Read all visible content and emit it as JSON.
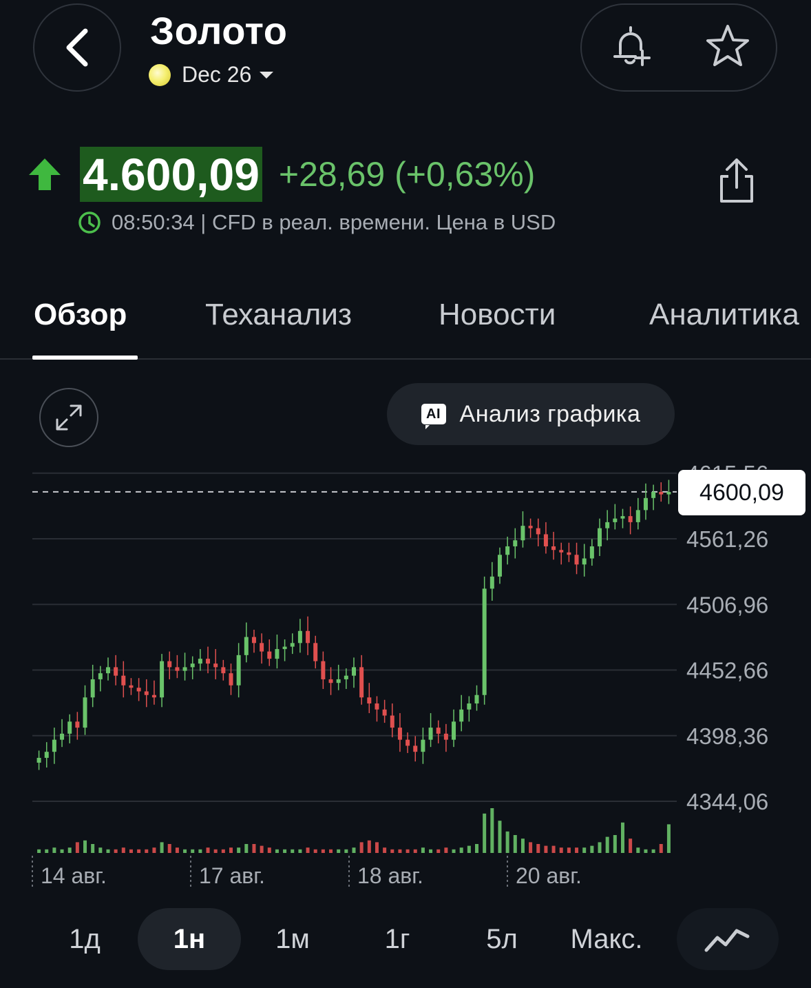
{
  "header": {
    "back_icon": "chevron-left-icon",
    "title": "Золото",
    "contract": "Dec 26",
    "alert_icon": "bell-plus-icon",
    "watchlist_icon": "star-icon"
  },
  "quote": {
    "direction_icon": "arrow-up-icon",
    "price": "4.600,09",
    "change": "+28,69 (+0,63%)",
    "time_info": "08:50:34 | CFD в реал. времени. Цена в USD",
    "share_icon": "share-icon",
    "up_color": "#6ac36a"
  },
  "tabs": [
    {
      "label": "Обзор",
      "active": true
    },
    {
      "label": "Теханализ",
      "active": false
    },
    {
      "label": "Новости",
      "active": false
    },
    {
      "label": "Аналитика",
      "active": false
    }
  ],
  "chart_controls": {
    "expand_icon": "expand-icon",
    "ai_badge": "AI",
    "ai_button": "Анализ графика"
  },
  "chart_data": {
    "type": "candlestick",
    "current_price_label": "4600,09",
    "current_price": 4600.09,
    "y_ticks": [
      "4561,26",
      "4506,96",
      "4452,66",
      "4398,36",
      "4344,06"
    ],
    "y_tick_values": [
      4561.26,
      4506.96,
      4452.66,
      4398.36,
      4344.06
    ],
    "top_tick_partial": "4615,56",
    "x_labels": [
      "14 авг.",
      "17 авг.",
      "18 авг.",
      "20 авг."
    ],
    "up_color": "#6ac36a",
    "down_color": "#e0504f",
    "candle_closes": [
      4380,
      4385,
      4395,
      4400,
      4410,
      4405,
      4430,
      4445,
      4450,
      4455,
      4448,
      4440,
      4438,
      4435,
      4432,
      4430,
      4460,
      4455,
      4452,
      4455,
      4458,
      4462,
      4458,
      4455,
      4450,
      4440,
      4465,
      4480,
      4475,
      4468,
      4462,
      4470,
      4472,
      4475,
      4485,
      4475,
      4460,
      4445,
      4442,
      4445,
      4448,
      4455,
      4430,
      4425,
      4420,
      4415,
      4405,
      4395,
      4390,
      4385,
      4395,
      4405,
      4400,
      4395,
      4410,
      4420,
      4425,
      4432,
      4520,
      4530,
      4548,
      4555,
      4560,
      4572,
      4570,
      4565,
      4555,
      4552,
      4550,
      4548,
      4540,
      4545,
      4555,
      4570,
      4575,
      4578,
      4580,
      4575,
      4585,
      4595,
      4600,
      4598,
      4600
    ],
    "volumes": [
      2,
      2,
      3,
      2,
      3,
      6,
      7,
      5,
      3,
      2,
      2,
      3,
      2,
      2,
      2,
      3,
      6,
      5,
      3,
      2,
      2,
      2,
      3,
      2,
      2,
      3,
      3,
      5,
      5,
      4,
      3,
      2,
      2,
      2,
      2,
      3,
      2,
      2,
      2,
      2,
      2,
      3,
      6,
      7,
      6,
      3,
      2,
      2,
      2,
      2,
      3,
      2,
      2,
      3,
      2,
      3,
      4,
      5,
      22,
      25,
      18,
      12,
      10,
      8,
      6,
      5,
      4,
      4,
      3,
      3,
      3,
      3,
      4,
      6,
      9,
      10,
      17,
      8,
      3,
      2,
      2,
      5,
      16
    ]
  },
  "periods": [
    {
      "label": "1д",
      "active": false
    },
    {
      "label": "1н",
      "active": true
    },
    {
      "label": "1м",
      "active": false
    },
    {
      "label": "1г",
      "active": false
    },
    {
      "label": "5л",
      "active": false
    },
    {
      "label": "Макс.",
      "active": false
    }
  ],
  "chart_type_icon": "line-chart-icon"
}
